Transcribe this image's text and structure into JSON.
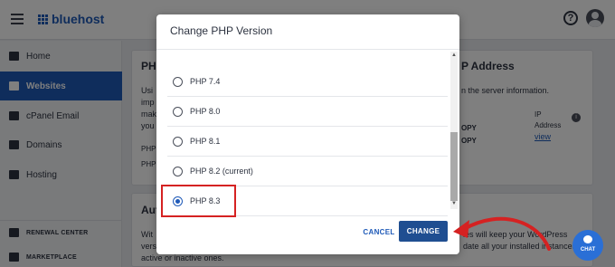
{
  "topbar": {
    "brand": "bluehost"
  },
  "sidebar": {
    "items": [
      {
        "label": "Home"
      },
      {
        "label": "Websites"
      },
      {
        "label": "cPanel Email"
      },
      {
        "label": "Domains"
      },
      {
        "label": "Hosting"
      }
    ],
    "footer": [
      {
        "label": "RENEWAL CENTER"
      },
      {
        "label": "MARKETPLACE"
      }
    ]
  },
  "background": {
    "php_card_head": "PH",
    "php_card_lines": [
      "Usi",
      "imp",
      "mak",
      "you"
    ],
    "php_card_small": [
      "PHP",
      "PHP"
    ],
    "ip_head": "P Address",
    "ip_desc": "n the server information.",
    "ip_copy": [
      "OPY",
      "OPY"
    ],
    "ip_label": "IP\nAddress",
    "ip_view": "view",
    "auto_head": "Aut",
    "auto_lines": [
      "Wit",
      "vers",
      "active or inactive ones."
    ],
    "auto_right": [
      "les will keep your WordPress",
      "date all your installed instances"
    ]
  },
  "modal": {
    "title": "Change PHP Version",
    "options": [
      {
        "label": "PHP 7.4",
        "checked": false
      },
      {
        "label": "PHP 8.0",
        "checked": false
      },
      {
        "label": "PHP 8.1",
        "checked": false
      },
      {
        "label": "PHP 8.2 (current)",
        "checked": false
      },
      {
        "label": "PHP 8.3",
        "checked": true
      }
    ],
    "cancel_label": "CANCEL",
    "change_label": "CHANGE"
  },
  "chat": {
    "label": "CHAT"
  },
  "colors": {
    "accent": "#1f5ab8",
    "highlight": "#d52222",
    "primary_button": "#1f4e91"
  }
}
